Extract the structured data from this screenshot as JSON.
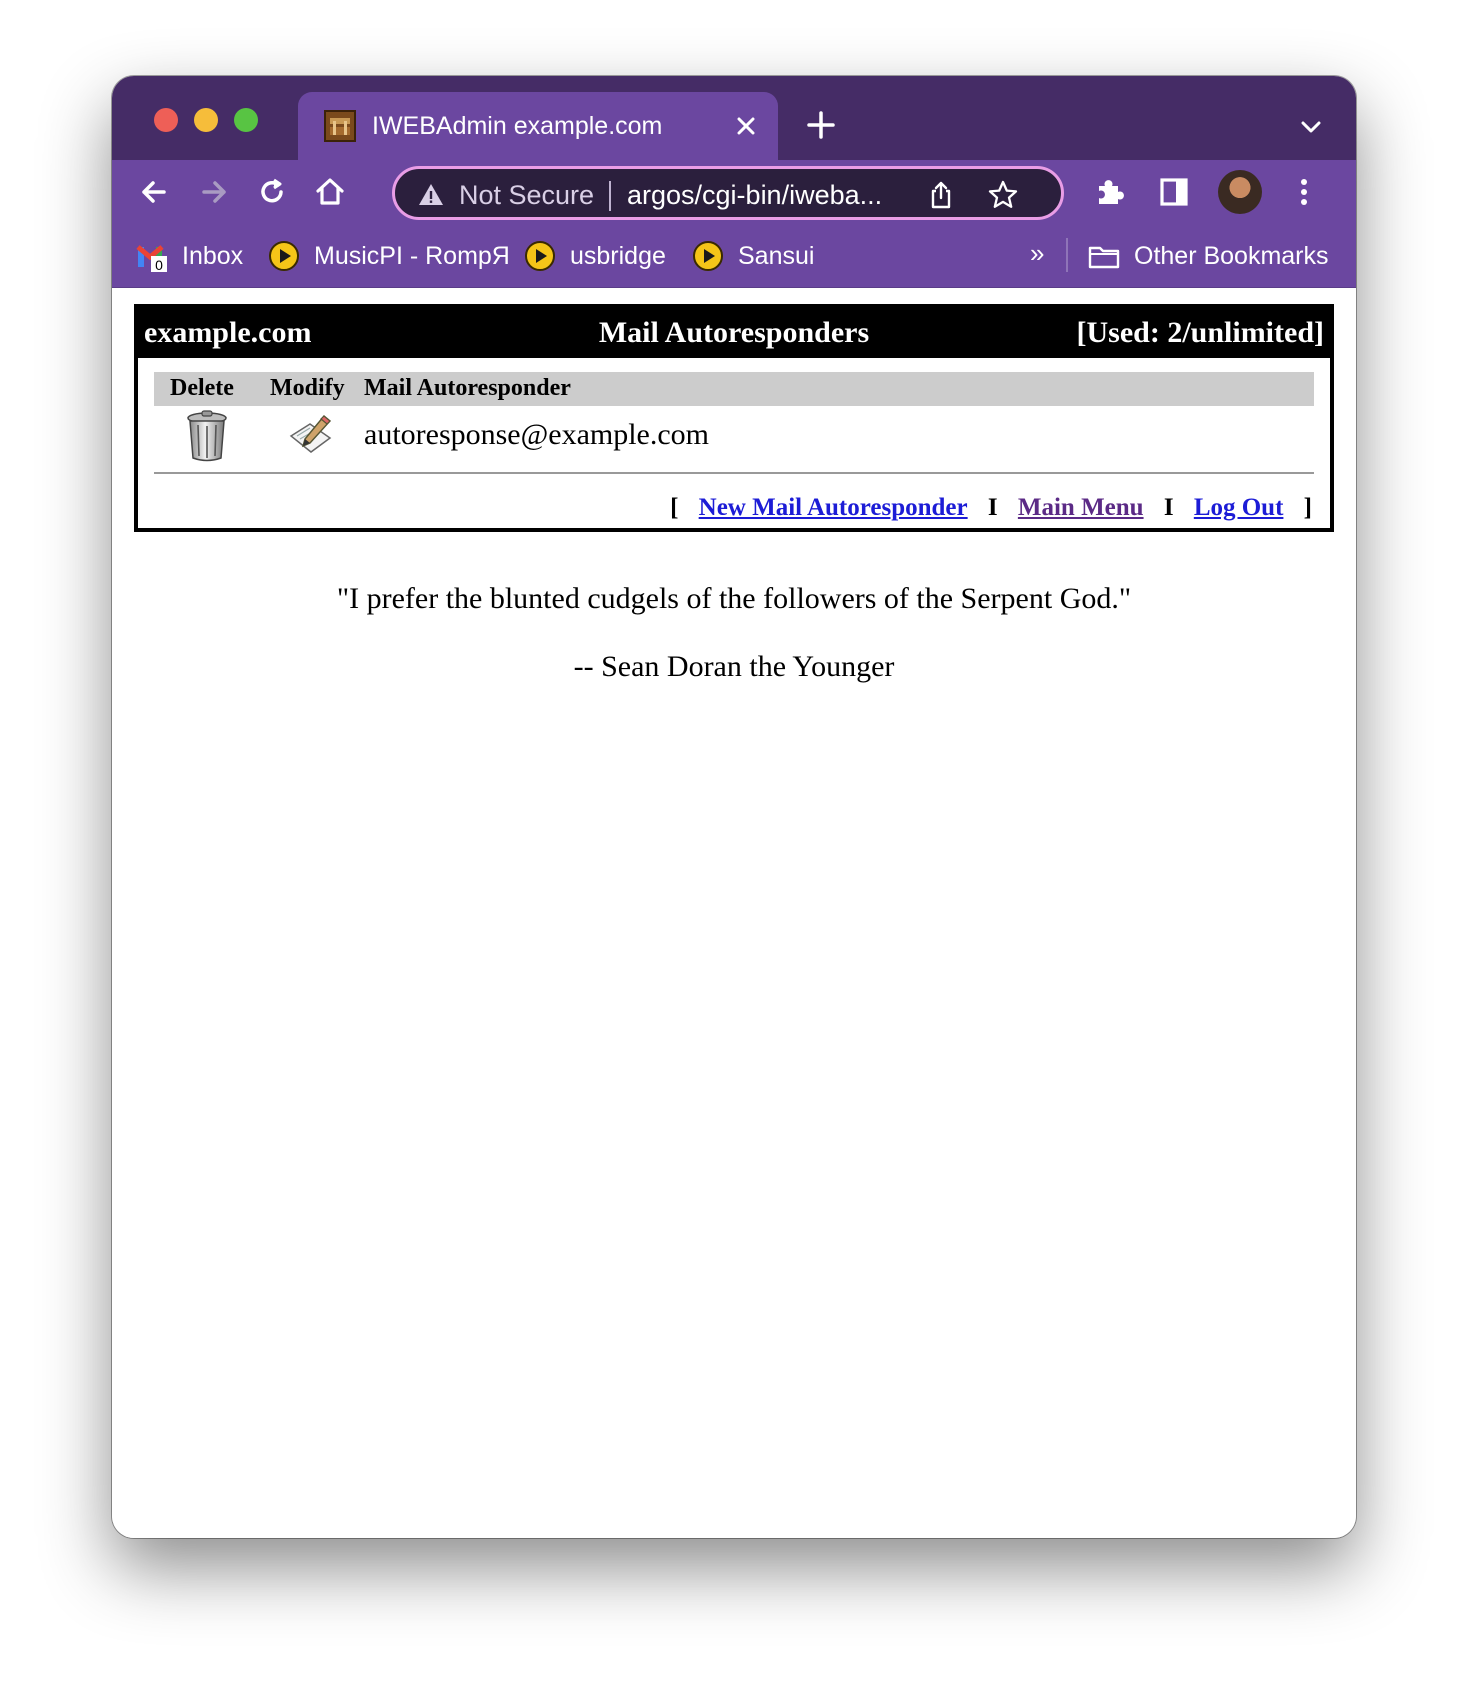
{
  "browser": {
    "tab_title": "IWEBAdmin example.com",
    "security_label": "Not Secure",
    "url": "argos/cgi-bin/iweba...",
    "bookmarks": [
      {
        "label": "Inbox",
        "icon": "gmail-icon"
      },
      {
        "label": "MusicPI - RompЯ",
        "icon": "play-circle-icon"
      },
      {
        "label": "usbridge",
        "icon": "play-circle-icon"
      },
      {
        "label": "Sansui",
        "icon": "play-circle-icon"
      }
    ],
    "overflow_label": "»",
    "other_bookmarks_label": "Other Bookmarks",
    "gmail_badge": "0",
    "colors": {
      "tabstrip": "#452c66",
      "toolbar": "#6b47a0",
      "omnibox": "#2b1f3d",
      "omnibox_focus": "#e99de6"
    }
  },
  "panel": {
    "domain": "example.com",
    "title": "Mail Autoresponders",
    "usage": "[Used: 2/unlimited]",
    "columns": {
      "delete": "Delete",
      "modify": "Modify",
      "name": "Mail Autoresponder"
    },
    "entries": [
      {
        "email": "autoresponse@example.com"
      }
    ],
    "links": {
      "open_bracket": "[",
      "new": "New Mail Autoresponder",
      "sep": "I",
      "main_menu": "Main Menu",
      "logout": "Log Out",
      "close_bracket": "]"
    }
  },
  "quote": {
    "text": "\"I prefer the blunted cudgels of the followers of the Serpent God.\"",
    "author": "-- Sean Doran the Younger"
  }
}
